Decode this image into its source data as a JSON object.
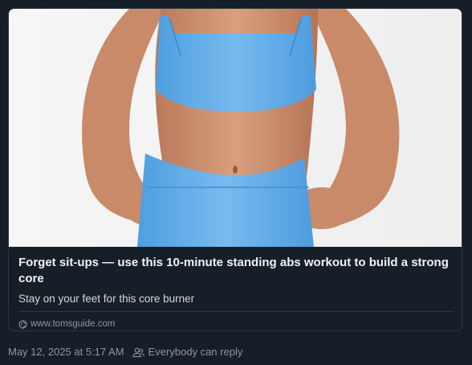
{
  "card": {
    "image_alt": "Woman in a blue sports bra and leggings with hands on hips",
    "title": "Forget sit-ups — use this 10-minute standing abs workout to build a strong core",
    "description": "Stay on your feet for this core burner",
    "domain": "www.tomsguide.com",
    "link_icon": "globe-icon"
  },
  "meta": {
    "timestamp": "May 12, 2025 at 5:17 AM",
    "reply_icon": "people-icon",
    "reply_setting": "Everybody can reply"
  }
}
